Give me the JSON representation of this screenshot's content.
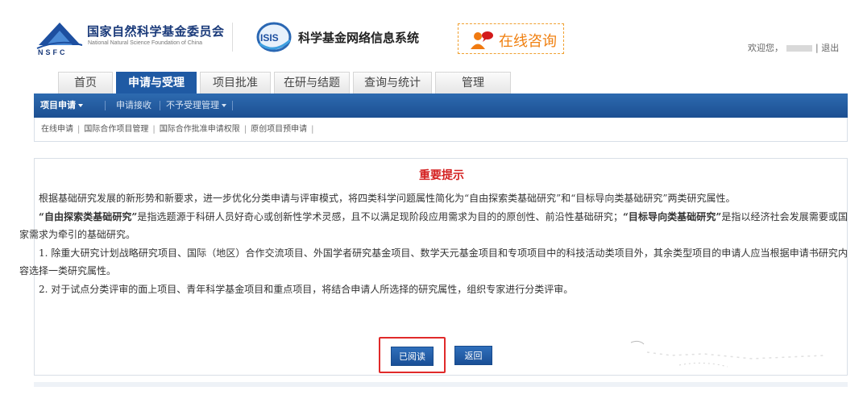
{
  "header": {
    "org_name_cn": "国家自然科学基金委员会",
    "org_name_en": "National Natural Science Foundation of China",
    "logo_letters": "NSFC",
    "system_logo_text": "ISIS",
    "system_name": "科学基金网络信息系统",
    "consult_label": "在线咨询",
    "welcome_prefix": "欢迎您，",
    "logout_sep": "|",
    "logout_label": "退出"
  },
  "tabs": [
    {
      "label": "首页",
      "active": false
    },
    {
      "label": "申请与受理",
      "active": true
    },
    {
      "label": "项目批准",
      "active": false
    },
    {
      "label": "在研与结题",
      "active": false
    },
    {
      "label": "查询与统计",
      "active": false
    },
    {
      "label": "管理",
      "active": false
    }
  ],
  "subnav": {
    "items": [
      {
        "label": "项目申请",
        "dropdown": true,
        "active": true
      },
      {
        "label": "申请接收",
        "dropdown": false,
        "active": false
      },
      {
        "label": "不予受理管理",
        "dropdown": true,
        "active": false
      }
    ]
  },
  "links": {
    "items": [
      "在线申请",
      "国际合作项目管理",
      "国际合作批准申请权限",
      "原创项目预申请"
    ],
    "separator": "|"
  },
  "notice": {
    "title": "重要提示",
    "p1": "根据基础研究发展的新形势和新要求，进一步优化分类申请与评审模式，将四类科学问题属性简化为“自由探索类基础研究”和“目标导向类基础研究”两类研究属性。",
    "p2_b1": "“自由探索类基础研究”",
    "p2_t1": "是指选题源于科研人员好奇心或创新性学术灵感，且不以满足现阶段应用需求为目的的原创性、前沿性基础研究；",
    "p2_b2": "“目标导向类基础研究”",
    "p2_t2": "是指以经济社会发展需要或国家需求为牵引的基础研究。",
    "p3": "1. 除重大研究计划战略研究项目、国际（地区）合作交流项目、外国学者研究基金项目、数学天元基金项目和专项项目中的科技活动类项目外，其余类型项目的申请人应当根据申请书研究内容选择一类研究属性。",
    "p4": "2. 对于试点分类评审的面上项目、青年科学基金项目和重点项目，将结合申请人所选择的研究属性，组织专家进行分类评审。",
    "read_button": "已阅读",
    "back_button": "返回"
  },
  "colors": {
    "nav_blue": "#1f5aa4",
    "notice_title_red": "#d42020",
    "consult_orange": "#f08010",
    "highlight_border": "#e02a2a"
  }
}
